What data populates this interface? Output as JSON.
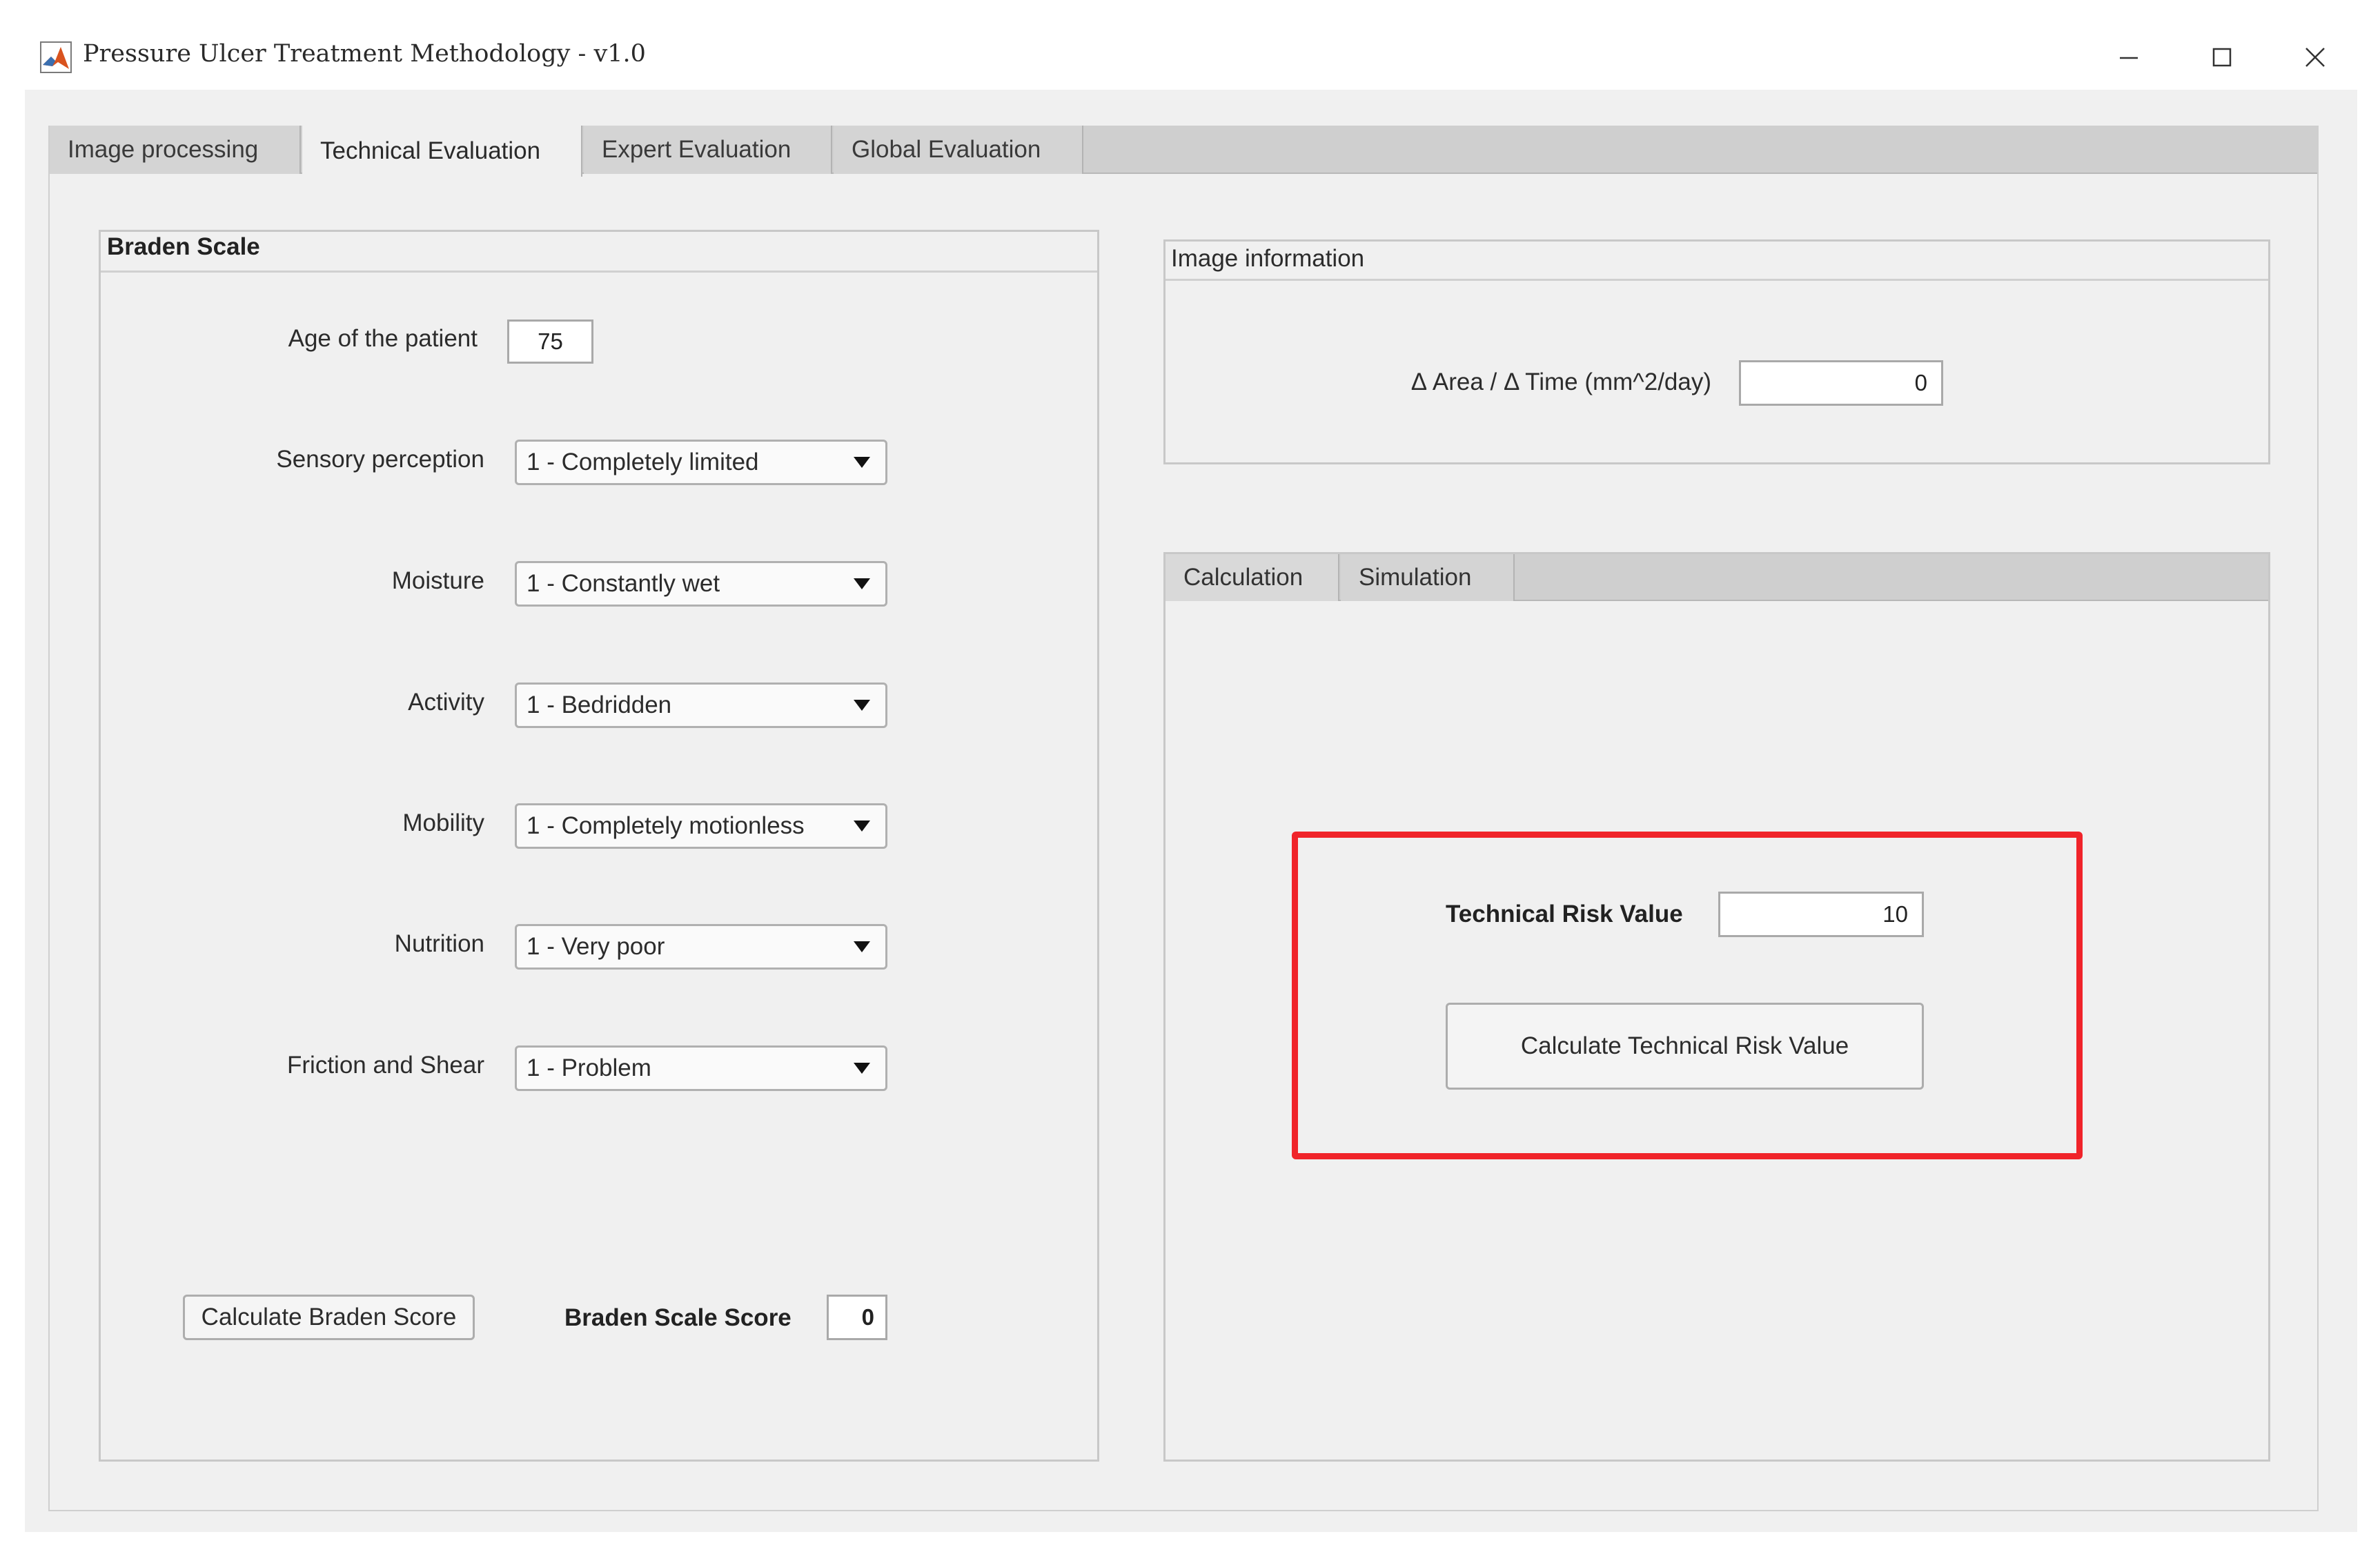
{
  "window": {
    "title": "Pressure Ulcer Treatment Methodology - v1.0",
    "controls": {
      "minimize": "minimize-icon",
      "maximize": "maximize-icon",
      "close": "close-icon"
    }
  },
  "tabs": [
    {
      "label": "Image processing",
      "active": false
    },
    {
      "label": "Technical Evaluation",
      "active": true
    },
    {
      "label": "Expert Evaluation",
      "active": false
    },
    {
      "label": "Global Evaluation",
      "active": false
    }
  ],
  "braden": {
    "title": "Braden Scale",
    "age_label": "Age of the patient",
    "age_value": "75",
    "fields": [
      {
        "label": "Sensory perception",
        "value": "1 - Completely limited"
      },
      {
        "label": "Moisture",
        "value": "1 - Constantly wet"
      },
      {
        "label": "Activity",
        "value": "1 - Bedridden"
      },
      {
        "label": "Mobility",
        "value": "1 - Completely motionless"
      },
      {
        "label": "Nutrition",
        "value": "1 - Very poor"
      },
      {
        "label": "Friction and Shear",
        "value": "1 - Problem"
      }
    ],
    "calc_button": "Calculate Braden Score",
    "score_label": "Braden Scale Score",
    "score_value": "0"
  },
  "image_info": {
    "title": "Image information",
    "rate_label": "Δ Area / Δ Time (mm^2/day)",
    "rate_value": "0"
  },
  "calc": {
    "subtabs": [
      {
        "label": "Calculation",
        "active": true
      },
      {
        "label": "Simulation",
        "active": false
      }
    ],
    "risk_label": "Technical Risk Value",
    "risk_value": "10",
    "calc_button": "Calculate Technical Risk Value"
  },
  "colors": {
    "highlight": "#f0242a",
    "window_bg": "#f0f0f0",
    "tab_bg": "#cfcfcf"
  }
}
